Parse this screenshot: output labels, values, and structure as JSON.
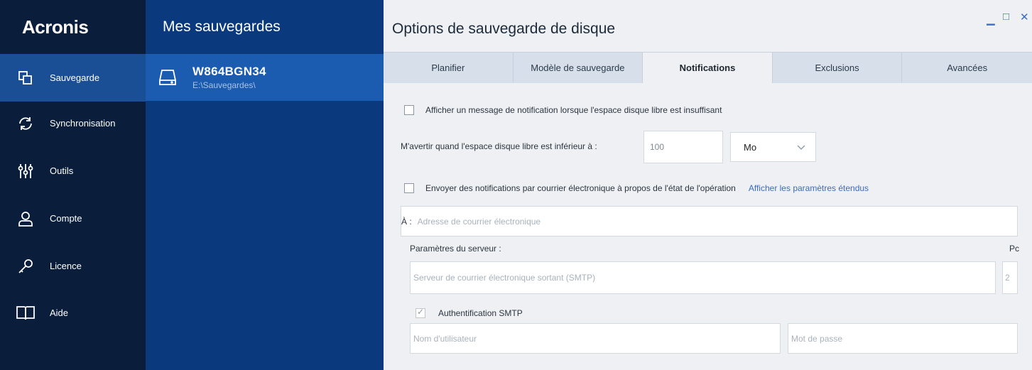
{
  "nav": {
    "logo": "Acronis",
    "items": [
      {
        "label": "Sauvegarde",
        "icon": "copy-icon",
        "active": true
      },
      {
        "label": "Synchronisation",
        "icon": "sync-icon"
      },
      {
        "label": "Outils",
        "icon": "tools-icon"
      },
      {
        "label": "Compte",
        "icon": "user-icon"
      },
      {
        "label": "Licence",
        "icon": "key-icon"
      },
      {
        "label": "Aide",
        "icon": "book-icon"
      }
    ]
  },
  "backups": {
    "title": "Mes sauvegardes",
    "items": [
      {
        "name": "W864BGN34",
        "path": "E:\\Sauvegardes\\",
        "icon": "drive-icon"
      }
    ]
  },
  "panel": {
    "title": "Options de sauvegarde de disque",
    "window_controls": {
      "minimize": "▁",
      "maximize": "□",
      "close": "✕"
    },
    "tabs": [
      {
        "label": "Planifier"
      },
      {
        "label": "Modèle de sauvegarde"
      },
      {
        "label": "Notifications",
        "active": true
      },
      {
        "label": "Exclusions"
      },
      {
        "label": "Avancées"
      }
    ],
    "notifications": {
      "low_space_checkbox": "Afficher un message de notification lorsque l'espace disque libre est insuffisant",
      "threshold_label": "M'avertir quand l'espace disque libre est inférieur à :",
      "threshold_value": "100",
      "unit_selected": "Mo",
      "email_checkbox": "Envoyer des notifications par courrier électronique à propos de l'état de l'opération",
      "extended_link": "Afficher les paramètres étendus",
      "to_label": "À :",
      "to_placeholder": "Adresse de courrier électronique",
      "server_label": "Paramètres du serveur :",
      "port_label": "Pc",
      "smtp_placeholder": "Serveur de courrier électronique sortant (SMTP)",
      "port_value": "2",
      "auth_checkbox": "Authentification SMTP",
      "username_placeholder": "Nom d'utilisateur",
      "password_placeholder": "Mot de passe"
    }
  },
  "colors": {
    "nav_bg": "#0a1e3c",
    "nav_active": "#1a4f95",
    "mid_bg": "#0a3a7d",
    "mid_selected": "#1b5bb0",
    "link": "#3a6cc4"
  }
}
